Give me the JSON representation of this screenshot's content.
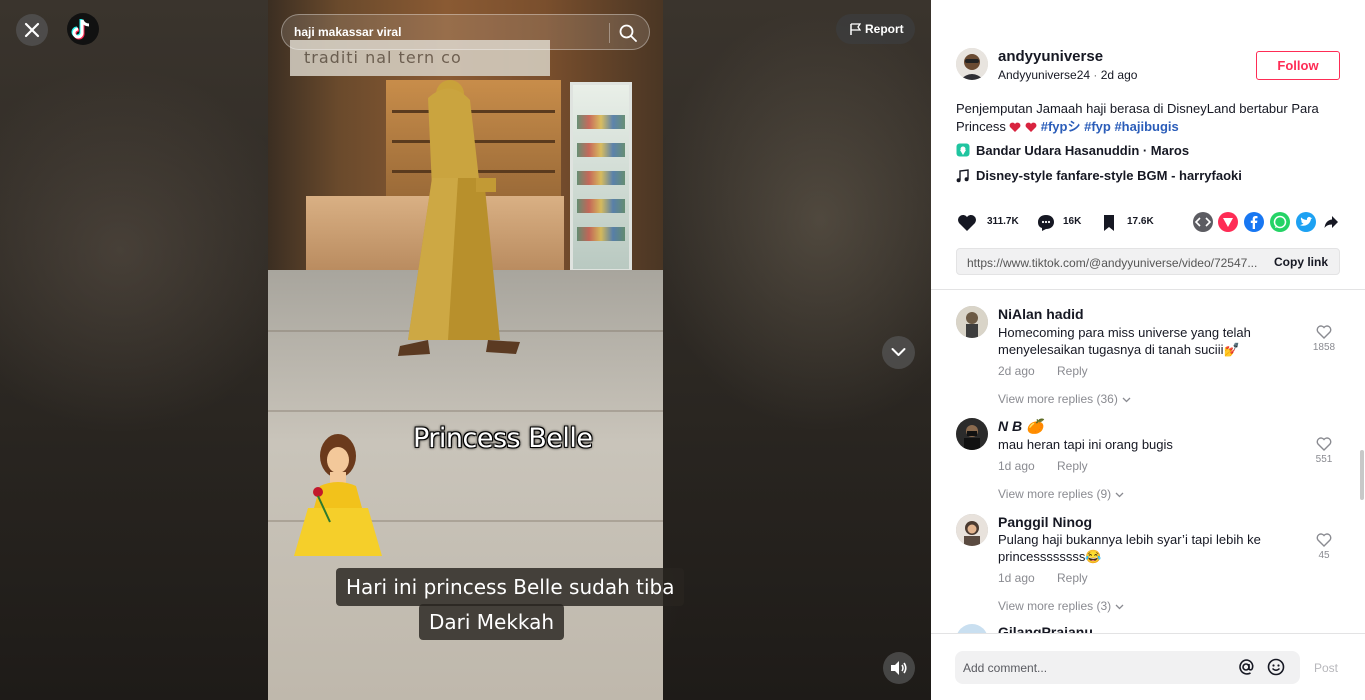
{
  "search": {
    "placeholder": "haji makassar viral",
    "value": "haji makassar viral"
  },
  "player": {
    "report_label": "Report",
    "overlay_title": "Princess Belle",
    "subtitle_line1": "Hari ini princess Belle sudah tiba",
    "subtitle_line2": "Dari Mekkah",
    "scene_sign_text": "traditi nal  tern co"
  },
  "author": {
    "name": "andyyuniverse",
    "handle": "Andyyuniverse24",
    "separator": "·",
    "posted": "2d ago",
    "follow_label": "Follow"
  },
  "description": {
    "text": "Penjemputan Jamaah haji berasa di DisneyLand bertabur Para Princess",
    "hashtags": [
      "#fypシ",
      "#fyp",
      "#hajibugis"
    ]
  },
  "location": "Bandar Udara Hasanuddin · Maros",
  "music": "Disney-style fanfare-style BGM - harryfaoki",
  "stats": {
    "likes": "311.7K",
    "comments": "16K",
    "saves": "17.6K"
  },
  "share_icons": [
    "embed-icon",
    "send-icon",
    "facebook-icon",
    "whatsapp-icon",
    "twitter-icon",
    "share-arrow-icon"
  ],
  "link": {
    "url": "https://www.tiktok.com/@andyyuniverse/video/72547...",
    "copy_label": "Copy link"
  },
  "comments": [
    {
      "name": "NiAlan hadid",
      "text": "Homecoming para miss universe yang telah menyelesaikan tugasnya di tanah suciii💅",
      "time": "2d ago",
      "reply_label": "Reply",
      "likes": "1858",
      "view_replies": "View more replies (36)"
    },
    {
      "name": "N B 🍊",
      "text": "mau heran tapi ini orang bugis",
      "time": "1d ago",
      "reply_label": "Reply",
      "likes": "551",
      "view_replies": "View more replies (9)"
    },
    {
      "name": "Panggil Ninog",
      "text": "Pulang haji bukannya lebih syar’i tapi lebih ke princessssssss😂",
      "time": "1d ago",
      "reply_label": "Reply",
      "likes": "45",
      "view_replies": "View more replies (3)"
    },
    {
      "name": "GilangPrajanu",
      "text": "",
      "time": "",
      "reply_label": "",
      "likes": "",
      "view_replies": ""
    }
  ],
  "composer": {
    "placeholder": "Add comment...",
    "post_label": "Post"
  },
  "colors": {
    "accent": "#fe2c55",
    "hashtag": "#2b5db9",
    "muted": "#8a8b91"
  }
}
